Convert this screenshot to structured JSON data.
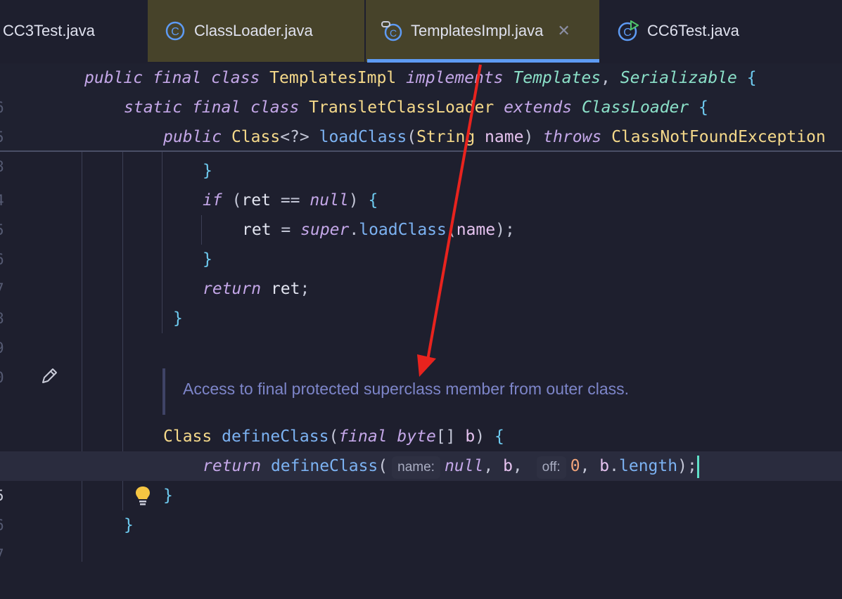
{
  "tabs": [
    {
      "label": "CC3Test.java",
      "icon": "class-test-icon"
    },
    {
      "label": "ClassLoader.java",
      "icon": "class-icon"
    },
    {
      "label": "TemplatesImpl.java",
      "icon": "class-locked-icon",
      "close": "✕"
    },
    {
      "label": "CC6Test.java",
      "icon": "class-run-icon"
    }
  ],
  "sticky": {
    "line1_ln": "6",
    "line2_ln": "5",
    "line3_ln": "8"
  },
  "lines": {
    "l1": "4",
    "l2": "5",
    "l3": "6",
    "l4": "7",
    "l5": "8",
    "l6": "9",
    "l7": "0",
    "l8": "4",
    "l9": "5",
    "l10": "6",
    "l11": "7"
  },
  "doc": {
    "text": "Access to final protected superclass member from outer class."
  },
  "inlay": {
    "name_hint": "name:",
    "off_hint": "off:"
  },
  "colors": {
    "accent": "#5e9bf4",
    "modified_tab": "#47432a",
    "background": "#1e1f2e",
    "arrow": "#e8231e"
  }
}
